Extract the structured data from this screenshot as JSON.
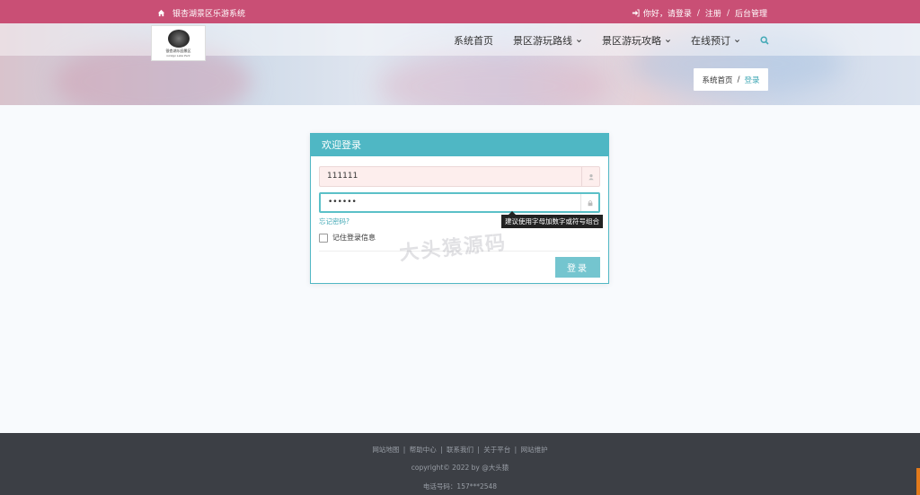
{
  "topbar": {
    "site_title": "银杏湖景区乐游系统",
    "greeting": "你好，请登录",
    "register": "注册",
    "admin": "后台管理",
    "separator": "/"
  },
  "logo": {
    "name": "银杏湖乐园景区",
    "sub": "Ginkgo Lake Park"
  },
  "nav": {
    "items": [
      {
        "label": "系统首页",
        "has_caret": false
      },
      {
        "label": "景区游玩路线",
        "has_caret": true
      },
      {
        "label": "景区游玩攻略",
        "has_caret": true
      },
      {
        "label": "在线预订",
        "has_caret": true
      }
    ],
    "search_icon": "search-icon"
  },
  "breadcrumb": {
    "home": "系统首页",
    "separator": "/",
    "current": "登录"
  },
  "login": {
    "title": "欢迎登录",
    "username_value": "111111",
    "password_value": "••••••",
    "forgot": "忘记密码?",
    "tooltip": "建议使用字母加数字或符号组合",
    "remember": "记住登录信息",
    "submit": "登录"
  },
  "watermark": "大头猿源码",
  "footer": {
    "links": [
      "网站地图",
      "帮助中心",
      "联系我们",
      "关于平台",
      "网站维护"
    ],
    "copyright": "copyright© 2022 by @大头猿",
    "phone": "电话号码：157***2548"
  },
  "colors": {
    "topbar": "#c94f75",
    "accent": "#4fb7c4",
    "footer": "#3c3f45"
  }
}
